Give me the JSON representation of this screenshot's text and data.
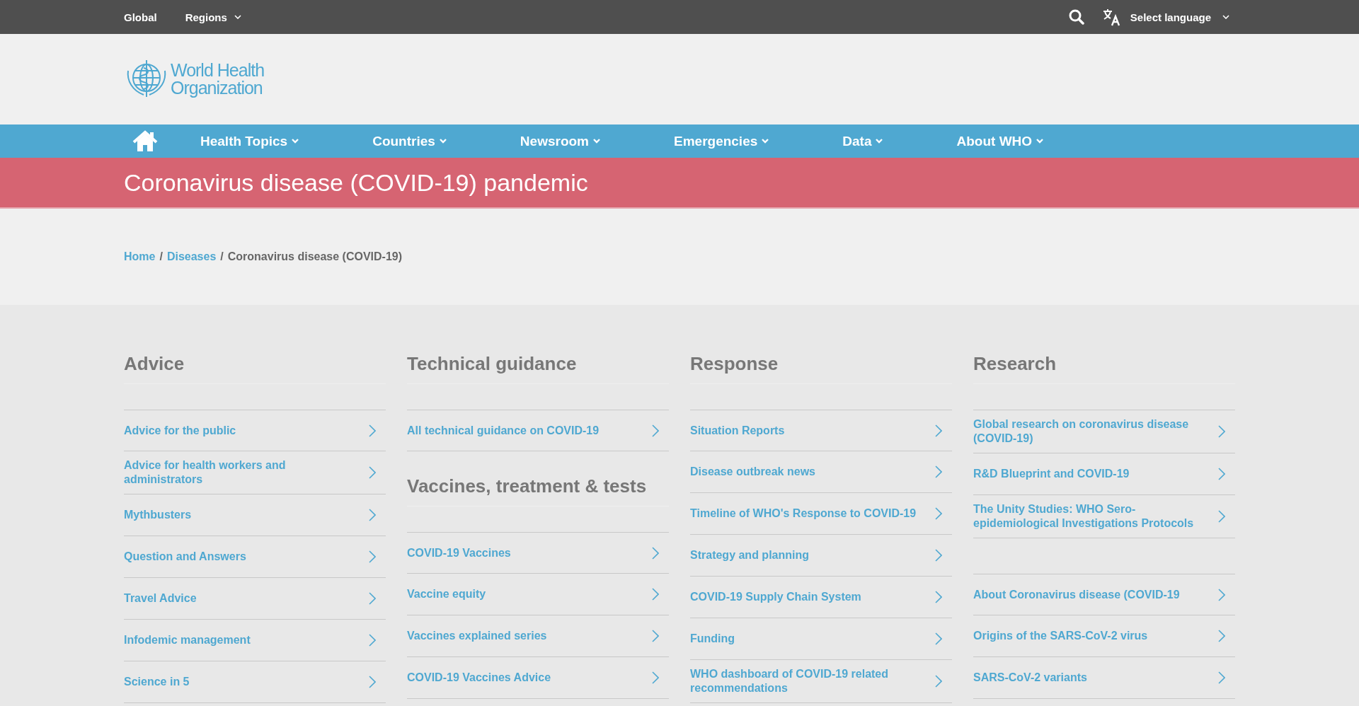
{
  "top_bar": {
    "links": [
      {
        "label": "Global",
        "has_menu": false
      },
      {
        "label": "Regions",
        "has_menu": true
      }
    ],
    "language": "Select language"
  },
  "logo": {
    "lines": [
      "World Health",
      "Organization"
    ]
  },
  "nav": {
    "items": [
      "Health Topics",
      "Countries",
      "Newsroom",
      "Emergencies",
      "Data",
      "About WHO"
    ]
  },
  "banner": {
    "title": "Coronavirus disease (COVID-19) pandemic"
  },
  "breadcrumb": {
    "separator": "/",
    "items": [
      {
        "label": "Home",
        "kind": "link"
      },
      {
        "label": "Diseases",
        "kind": "link"
      },
      {
        "label": "Coronavirus disease (COVID-19)",
        "kind": "current"
      }
    ]
  },
  "columns": [
    {
      "groups": [
        {
          "heading": "Advice",
          "links": [
            "Advice for the public",
            "Advice for health workers and administrators",
            "Mythbusters",
            "Question and Answers",
            "Travel Advice",
            "Infodemic management",
            "Science in 5"
          ]
        }
      ]
    },
    {
      "groups": [
        {
          "heading": "Technical guidance",
          "links": [
            "All technical guidance on COVID-19"
          ]
        },
        {
          "heading": "Vaccines, treatment & tests",
          "links": [
            "COVID-19 Vaccines",
            "Vaccine equity",
            "Vaccines explained series",
            "COVID-19 Vaccines Advice"
          ]
        }
      ]
    },
    {
      "groups": [
        {
          "heading": "Response",
          "links": [
            "Situation Reports",
            "Disease outbreak news",
            "Timeline of WHO's Response to COVID-19",
            "Strategy and planning",
            "COVID-19 Supply Chain System",
            "Funding",
            "WHO dashboard of COVID-19 related recommendations"
          ]
        }
      ]
    },
    {
      "groups": [
        {
          "heading": "Research",
          "links": [
            "Global research on coronavirus disease (COVID-19)",
            "R&D Blueprint and COVID-19",
            "The Unity Studies: WHO Sero-epidemiological Investigations Protocols"
          ]
        },
        {
          "links": [
            "About Coronavirus disease (COVID-19",
            "Origins of the SARS-CoV-2 virus",
            "SARS-CoV-2 variants"
          ]
        }
      ]
    }
  ]
}
